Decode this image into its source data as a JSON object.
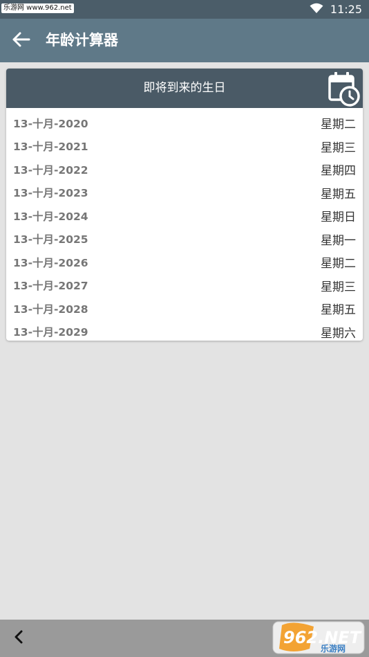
{
  "status_bar": {
    "watermark": "乐游网 www.962.net",
    "time": "11:25",
    "icons": [
      "wifi-icon",
      "battery-icon"
    ]
  },
  "app_bar": {
    "title": "年龄计算器",
    "back_icon": "arrow-left-icon"
  },
  "card": {
    "title": "即将到来的生日",
    "icon": "calendar-clock-icon",
    "rows": [
      {
        "date": "13-十月-2020",
        "weekday": "星期二"
      },
      {
        "date": "13-十月-2021",
        "weekday": "星期三"
      },
      {
        "date": "13-十月-2022",
        "weekday": "星期四"
      },
      {
        "date": "13-十月-2023",
        "weekday": "星期五"
      },
      {
        "date": "13-十月-2024",
        "weekday": "星期日"
      },
      {
        "date": "13-十月-2025",
        "weekday": "星期一"
      },
      {
        "date": "13-十月-2026",
        "weekday": "星期二"
      },
      {
        "date": "13-十月-2027",
        "weekday": "星期三"
      },
      {
        "date": "13-十月-2028",
        "weekday": "星期五"
      },
      {
        "date": "13-十月-2029",
        "weekday": "星期六"
      }
    ]
  },
  "nav_bar": {
    "back_icon": "chevron-left-icon",
    "logo_text": "962.NET",
    "logo_subtext": "乐游网"
  },
  "colors": {
    "status_bar": "#4b5d69",
    "app_bar": "#5f7988",
    "card_header": "#4a5a66",
    "background": "#e3e3e3",
    "nav_bar": "#9a9a9a"
  }
}
